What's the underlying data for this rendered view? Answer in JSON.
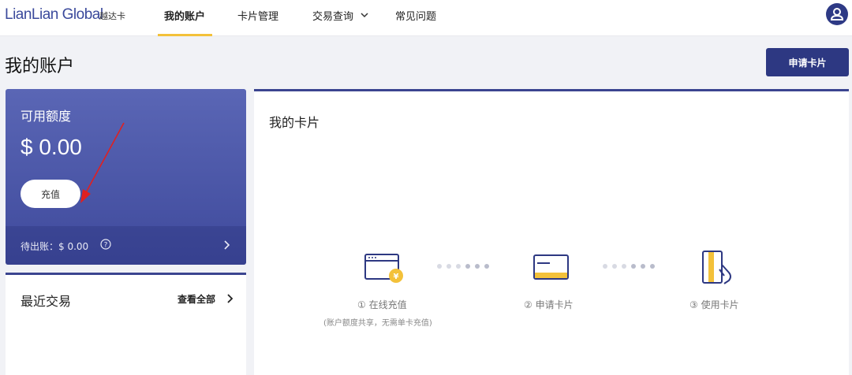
{
  "nav": {
    "logo": "LianLian Global",
    "logo_sub": "越达卡",
    "items": [
      {
        "label": "我的账户"
      },
      {
        "label": "卡片管理"
      },
      {
        "label": "交易查询"
      },
      {
        "label": "常见问题"
      }
    ]
  },
  "page": {
    "title": "我的账户",
    "apply_button": "申请卡片"
  },
  "balance": {
    "label": "可用额度",
    "amount": "$ 0.00",
    "topup_button": "充值",
    "pending": "待出账：$ 0.00"
  },
  "recent": {
    "title": "最近交易",
    "view_all": "查看全部"
  },
  "cards": {
    "title": "我的卡片",
    "steps": [
      {
        "label": "① 在线充值",
        "note": "(账户额度共享，无需单卡充值)"
      },
      {
        "label": "② 申请卡片"
      },
      {
        "label": "③ 使用卡片"
      }
    ]
  },
  "colors": {
    "primary": "#2d3882",
    "accent": "#f3c13a",
    "card_gradient_top": "#5a66b5",
    "card_gradient_bottom": "#3f4a9c",
    "annotation": "#e02020"
  },
  "icons": {
    "avatar": "user-icon",
    "nav_dropdown": "chevron-down-icon",
    "help": "question-circle-icon",
    "pending_chevron": "chevron-right-icon",
    "step1": "browser-yen-icon",
    "step2": "credit-card-icon",
    "step3": "card-in-hand-icon"
  }
}
